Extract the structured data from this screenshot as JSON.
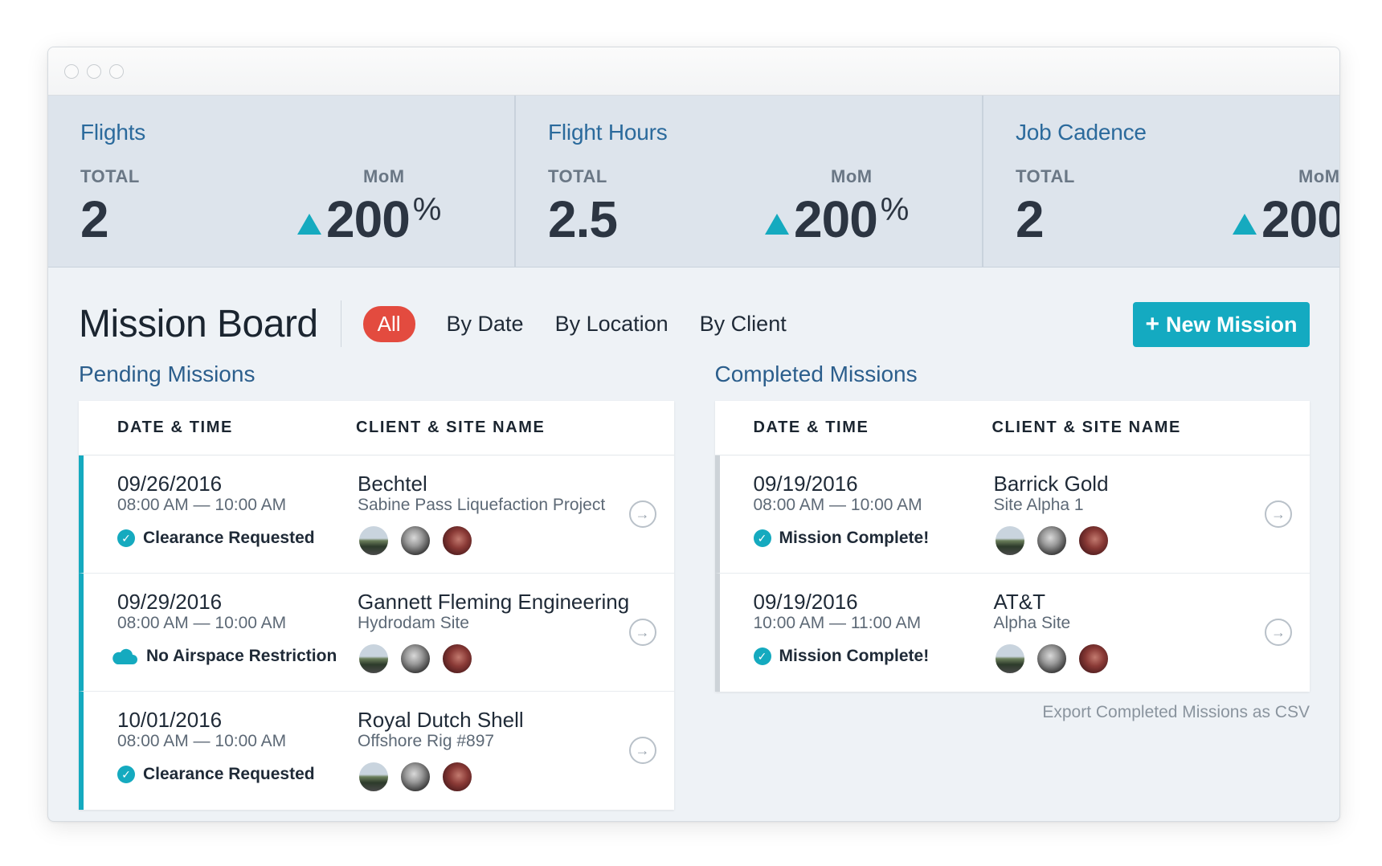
{
  "stats": [
    {
      "title": "Flights",
      "total_label": "TOTAL",
      "total": "2",
      "mom_label": "MoM",
      "mom": "200",
      "mom_unit": "%"
    },
    {
      "title": "Flight Hours",
      "total_label": "TOTAL",
      "total": "2.5",
      "mom_label": "MoM",
      "mom": "200",
      "mom_unit": "%"
    },
    {
      "title": "Job Cadence",
      "total_label": "TOTAL",
      "total": "2",
      "mom_label": "MoM",
      "mom": "200",
      "mom_unit": ""
    }
  ],
  "board": {
    "title": "Mission Board",
    "filters": [
      "All",
      "By Date",
      "By Location",
      "By Client"
    ],
    "new_button": "New Mission",
    "new_button_icon": "plus-icon"
  },
  "pending": {
    "title": "Pending Missions",
    "headers": [
      "DATE & TIME",
      "CLIENT & SITE NAME"
    ],
    "rows": [
      {
        "date": "09/26/2016",
        "time": "08:00 AM — 10:00 AM",
        "status": "Clearance Requested",
        "status_icon": "check-circle-icon",
        "client": "Bechtel",
        "site": "Sabine Pass Liquefaction Project"
      },
      {
        "date": "09/29/2016",
        "time": "08:00 AM — 10:00 AM",
        "status": "No Airspace Restriction",
        "status_icon": "cloud-icon",
        "client": "Gannett Fleming Engineering",
        "site": "Hydrodam Site"
      },
      {
        "date": "10/01/2016",
        "time": "08:00 AM — 10:00 AM",
        "status": "Clearance Requested",
        "status_icon": "check-circle-icon",
        "client": "Royal Dutch Shell",
        "site": "Offshore Rig #897"
      }
    ]
  },
  "completed": {
    "title": "Completed Missions",
    "headers": [
      "DATE & TIME",
      "CLIENT & SITE NAME"
    ],
    "rows": [
      {
        "date": "09/19/2016",
        "time": "08:00 AM — 10:00 AM",
        "status": "Mission Complete!",
        "status_icon": "check-circle-icon",
        "client": "Barrick Gold",
        "site": "Site Alpha 1"
      },
      {
        "date": "09/19/2016",
        "time": "10:00 AM — 11:00 AM",
        "status": "Mission Complete!",
        "status_icon": "check-circle-icon",
        "client": "AT&T",
        "site": "Alpha Site"
      }
    ],
    "export_link": "Export Completed Missions as CSV"
  },
  "colors": {
    "accent": "#15aabf",
    "filter_active": "#e34b3f",
    "link": "#2b6a9c"
  }
}
